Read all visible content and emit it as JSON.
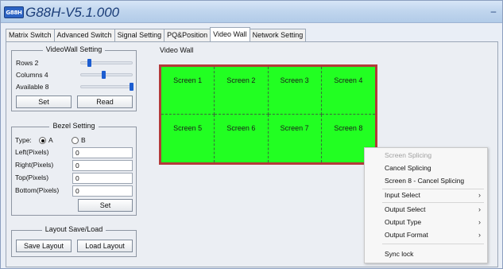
{
  "app": {
    "icon_text": "G88H",
    "title": "G88H-V5.1.000",
    "minimize_glyph": "–"
  },
  "tabs": [
    {
      "label": "Matrix Switch"
    },
    {
      "label": "Advanced Switch"
    },
    {
      "label": "Signal Setting"
    },
    {
      "label": "PQ&Position"
    },
    {
      "label": "Video Wall"
    },
    {
      "label": "Network Setting"
    }
  ],
  "active_tab": "Video Wall",
  "videowall_setting": {
    "title": "VideoWall Setting",
    "rows": {
      "label": "Rows 2",
      "value": 2
    },
    "columns": {
      "label": "Columns 4",
      "value": 4
    },
    "available": {
      "label": "Available 8",
      "value": 8
    },
    "set_label": "Set",
    "read_label": "Read"
  },
  "bezel_setting": {
    "title": "Bezel Setting",
    "type_label": "Type:",
    "option_a": "A",
    "option_b": "B",
    "selected": "A",
    "left_label": "Left(Pixels)",
    "left_value": "0",
    "right_label": "Right(Pixels)",
    "right_value": "0",
    "top_label": "Top(Pixels)",
    "top_value": "0",
    "bottom_label": "Bottom(Pixels)",
    "bottom_value": "0",
    "set_label": "Set"
  },
  "layout": {
    "title": "Layout Save/Load",
    "save_label": "Save Layout",
    "load_label": "Load Layout"
  },
  "video_wall": {
    "label": "Video Wall",
    "screens": [
      "Screen 1",
      "Screen 2",
      "Screen 3",
      "Screen 4",
      "Screen 5",
      "Screen 6",
      "Screen 7",
      "Screen 8"
    ],
    "fill_color": "#22ff22",
    "border_color": "#b33a3a"
  },
  "context_menu": {
    "items": [
      {
        "label": "Screen Splicing",
        "disabled": true,
        "submenu": false
      },
      {
        "label": "Cancel Splicing",
        "disabled": false,
        "submenu": false
      },
      {
        "label": "Screen 8 - Cancel Splicing",
        "disabled": false,
        "submenu": false
      },
      {
        "label": "Input Select",
        "disabled": false,
        "submenu": true
      },
      {
        "label": "Output Select",
        "disabled": false,
        "submenu": true
      },
      {
        "label": "Output Type",
        "disabled": false,
        "submenu": true
      },
      {
        "label": "Output Format",
        "disabled": false,
        "submenu": true
      },
      {
        "label": "Sync lock",
        "disabled": false,
        "submenu": false
      }
    ],
    "arrow": "›"
  }
}
